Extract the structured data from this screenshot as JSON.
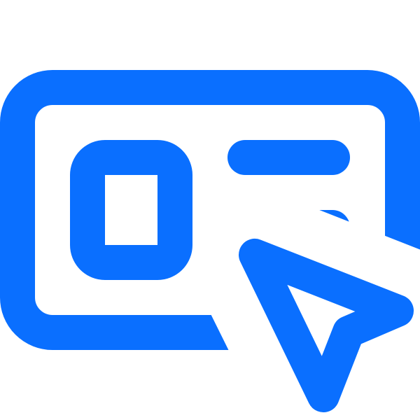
{
  "icon": {
    "name": "card-cursor-click-icon",
    "color": "#0A6FFF",
    "background": "#FFFFFF",
    "parts": [
      "card-frame",
      "image-placeholder",
      "text-line",
      "text-line-short",
      "cursor-arrow"
    ]
  }
}
